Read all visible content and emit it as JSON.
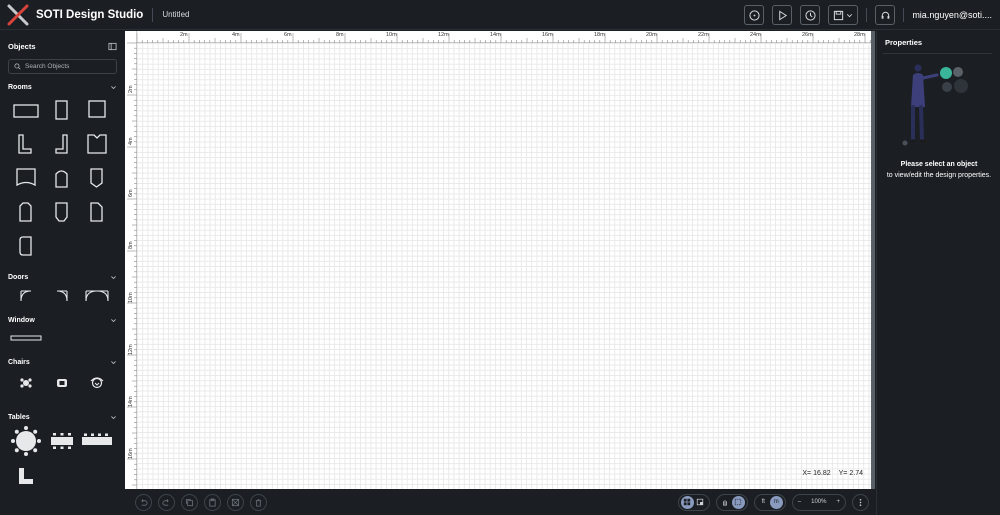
{
  "header": {
    "brand": "SOTI Design Studio",
    "document_title": "Untitled",
    "user": "mia.nguyen@soti....",
    "buttons": [
      "info-icon",
      "play-icon",
      "history-icon",
      "save-icon",
      "support-icon"
    ]
  },
  "objects_panel": {
    "title": "Objects",
    "search_placeholder": "Search Objects",
    "sections": [
      {
        "label": "Rooms"
      },
      {
        "label": "Doors"
      },
      {
        "label": "Window"
      },
      {
        "label": "Chairs"
      },
      {
        "label": "Tables"
      }
    ]
  },
  "ruler": {
    "top": [
      "2m",
      "4m",
      "6m",
      "8m",
      "10m",
      "12m",
      "14m",
      "16m",
      "18m",
      "20m",
      "22m",
      "24m",
      "26m",
      "28m"
    ],
    "left": [
      "2m",
      "4m",
      "6m",
      "8m",
      "10m",
      "12m",
      "14m",
      "16m"
    ]
  },
  "canvas": {
    "x_label": "X=",
    "x_value": "16.82",
    "y_label": "Y=",
    "y_value": "2.74"
  },
  "bottom": {
    "unit_ft": "ft",
    "unit_m": "m",
    "selected_unit": "m",
    "zoom": "100%",
    "zoom_minus": "–",
    "zoom_plus": "+"
  },
  "properties_panel": {
    "title": "Properties",
    "message_bold": "Please select an object",
    "message": "to view/edit the design properties."
  },
  "colors": {
    "background": "#1b1f24",
    "canvas": "#ffffff",
    "accent": "#3bb59a",
    "toggle_on": "#8a9bc0"
  }
}
